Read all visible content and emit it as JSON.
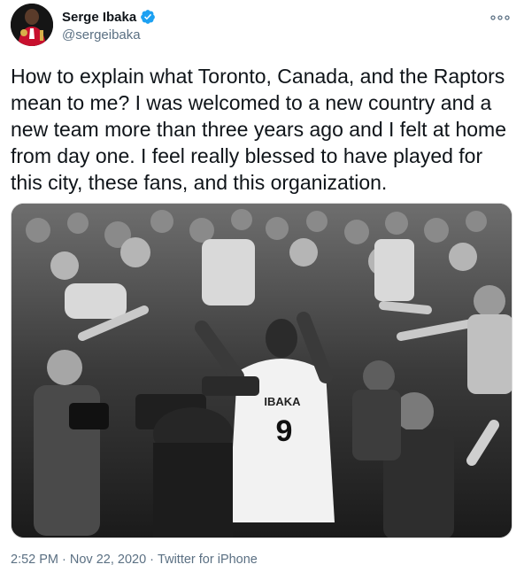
{
  "author": {
    "display_name": "Serge Ibaka",
    "handle": "@sergeibaka",
    "verified": true
  },
  "icons": {
    "avatar": "avatar",
    "verified": "verified-badge-icon",
    "more": "more-options-icon"
  },
  "tweet": {
    "text": "How to explain what Toronto, Canada, and the Raptors mean to me? I was welcomed to a new country and a new team more than three years ago and I felt at home from day one. I feel really blessed to have played for this city, these fans, and this organization."
  },
  "photo": {
    "jersey_name": "IBAKA",
    "jersey_number": "9"
  },
  "meta": {
    "time": "2:52 PM",
    "separator": " · ",
    "date": "Nov 22, 2020",
    "source": "Twitter for iPhone"
  },
  "colors": {
    "verified_blue": "#1da1f2",
    "secondary_text": "#5b7083",
    "primary_text": "#0f1419"
  }
}
